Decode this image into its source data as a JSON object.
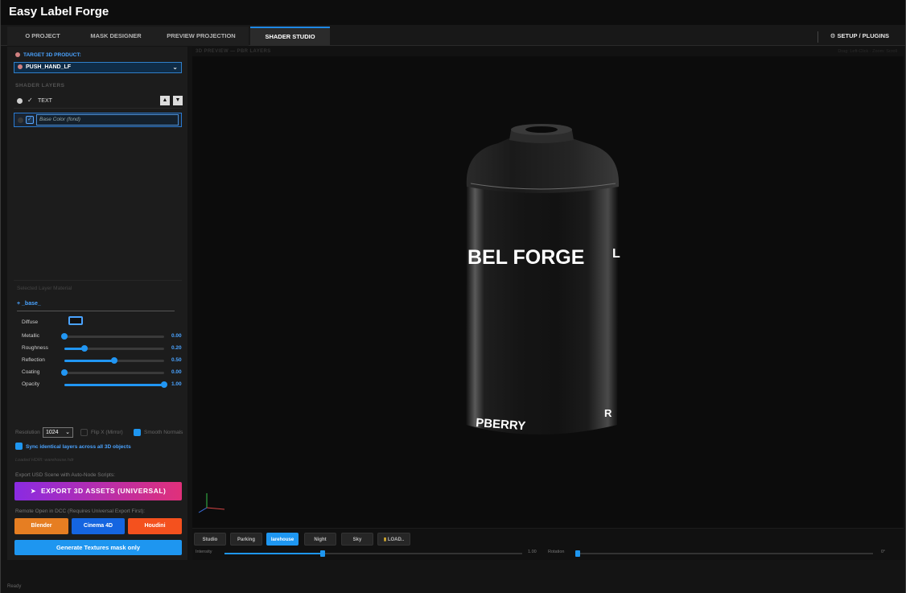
{
  "app": {
    "title": "Easy Label Forge"
  },
  "tabs": [
    {
      "label": "O PROJECT",
      "active": false
    },
    {
      "label": "MASK DESIGNER",
      "active": false
    },
    {
      "label": "PREVIEW PROJECTION",
      "active": false
    },
    {
      "label": "SHADER STUDIO",
      "active": true
    }
  ],
  "setup": {
    "label": "SETUP / PLUGINS",
    "icon": "gear-icon"
  },
  "left": {
    "target_label": "TARGET 3D PRODUCT:",
    "product_value": "PUSH_HAND_LF",
    "shader_layers_label": "SHADER LAYERS",
    "layers": [
      {
        "name": "TEXT",
        "visible": true,
        "checked": true
      },
      {
        "name": "Base Color (fond)",
        "visible": false,
        "checked": true
      }
    ],
    "material": {
      "title": "Selected Layer Material",
      "name": "+ _base_",
      "diffuse_label": "Diffuse",
      "diffuse_color": "#111111",
      "props": [
        {
          "label": "Metallic",
          "value": "0.00",
          "level": 0.0
        },
        {
          "label": "Roughness",
          "value": "0.20",
          "level": 0.2
        },
        {
          "label": "Reflection",
          "value": "0.50",
          "level": 0.5
        },
        {
          "label": "Coating",
          "value": "0.00",
          "level": 0.0
        },
        {
          "label": "Opacity",
          "value": "1.00",
          "level": 1.0
        }
      ]
    },
    "resolution_label": "Resolution",
    "resolution_value": "1024",
    "flip_label": "Flip X (Mirror)",
    "smooth_label": "Smooth Normals",
    "sync_label": "Sync identical layers across all 3D objects",
    "hdri_text": "Loaded HDRI: warehouse.hdr",
    "usd_text": "Export USD Scene with Auto-Node Scripts:",
    "export_label": "EXPORT 3D ASSETS (UNIVERSAL)",
    "remote_text": "Remote Open in DCC (Requires Universal Export First):",
    "dcc": [
      {
        "label": "Blender",
        "color": "#e67e22"
      },
      {
        "label": "Cinema 4D",
        "color": "#1565e0"
      },
      {
        "label": "Houdini",
        "color": "#f4511e"
      }
    ],
    "generate_label": "Generate Textures mask only"
  },
  "preview": {
    "title": "3D PREVIEW — PBR LAYERS",
    "hint": "Drag: Left-Click · Zoom: Scroll",
    "label_main": "BEL FORGE",
    "label_side": "L",
    "label_bottom": "PBERRY",
    "label_bottom_side": "R",
    "env_buttons": [
      {
        "label": "Studio",
        "active": false
      },
      {
        "label": "Parking",
        "active": false
      },
      {
        "label": "larehouse",
        "active": true
      },
      {
        "label": "Night",
        "active": false
      },
      {
        "label": "Sky",
        "active": false
      },
      {
        "label": "LOAD..",
        "active": false
      }
    ],
    "intensity_label": "Intensity",
    "intensity_value": "1.00",
    "intensity_level": 0.33,
    "rotation_label": "Rotation",
    "rotation_value": "0°",
    "rotation_level": 0.0
  },
  "status": {
    "text": "Ready"
  },
  "colors": {
    "accent": "#1e96f0",
    "link": "#4aa3ff"
  }
}
